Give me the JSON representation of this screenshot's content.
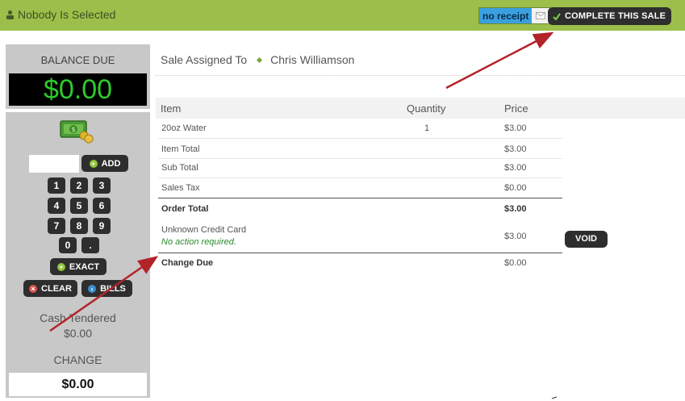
{
  "topbar": {
    "customer_label": "Nobody Is Selected",
    "receipt_label": "no receipt",
    "complete_label": "COMPLETE THIS SALE",
    "bg_color": "#9bbf4a"
  },
  "left_panel": {
    "balance_title": "BALANCE DUE",
    "balance_value": "$0.00",
    "add_label": "ADD",
    "keys": [
      "1",
      "2",
      "3",
      "4",
      "5",
      "6",
      "7",
      "8",
      "9",
      "0",
      "."
    ],
    "exact_label": "EXACT",
    "clear_label": "CLEAR",
    "bills_label": "BILLS",
    "cash_tendered_label": "Cash Tendered",
    "cash_tendered_value": "$0.00",
    "change_label": "CHANGE",
    "change_value": "$0.00"
  },
  "sale": {
    "assigned_label": "Sale Assigned To",
    "assigned_name": "Chris Williamson"
  },
  "table": {
    "headers": {
      "item": "Item",
      "quantity": "Quantity",
      "price": "Price"
    },
    "line_item": {
      "name": "20oz Water",
      "quantity": "1",
      "price": "$3.00"
    },
    "item_total": {
      "label": "Item Total",
      "value": "$3.00"
    },
    "sub_total": {
      "label": "Sub Total",
      "value": "$3.00"
    },
    "sales_tax": {
      "label": "Sales Tax",
      "value": "$0.00"
    },
    "order_total": {
      "label": "Order Total",
      "value": "$3.00"
    },
    "payment": {
      "method": "Unknown Credit Card",
      "note": "No action required.",
      "value": "$3.00",
      "void_label": "VOID"
    },
    "change_due": {
      "label": "Change Due",
      "value": "$0.00"
    }
  },
  "colors": {
    "accent_green": "#9bbf4a",
    "display_green": "#2ccc2c",
    "annotation_arrow": "#b3232a"
  }
}
